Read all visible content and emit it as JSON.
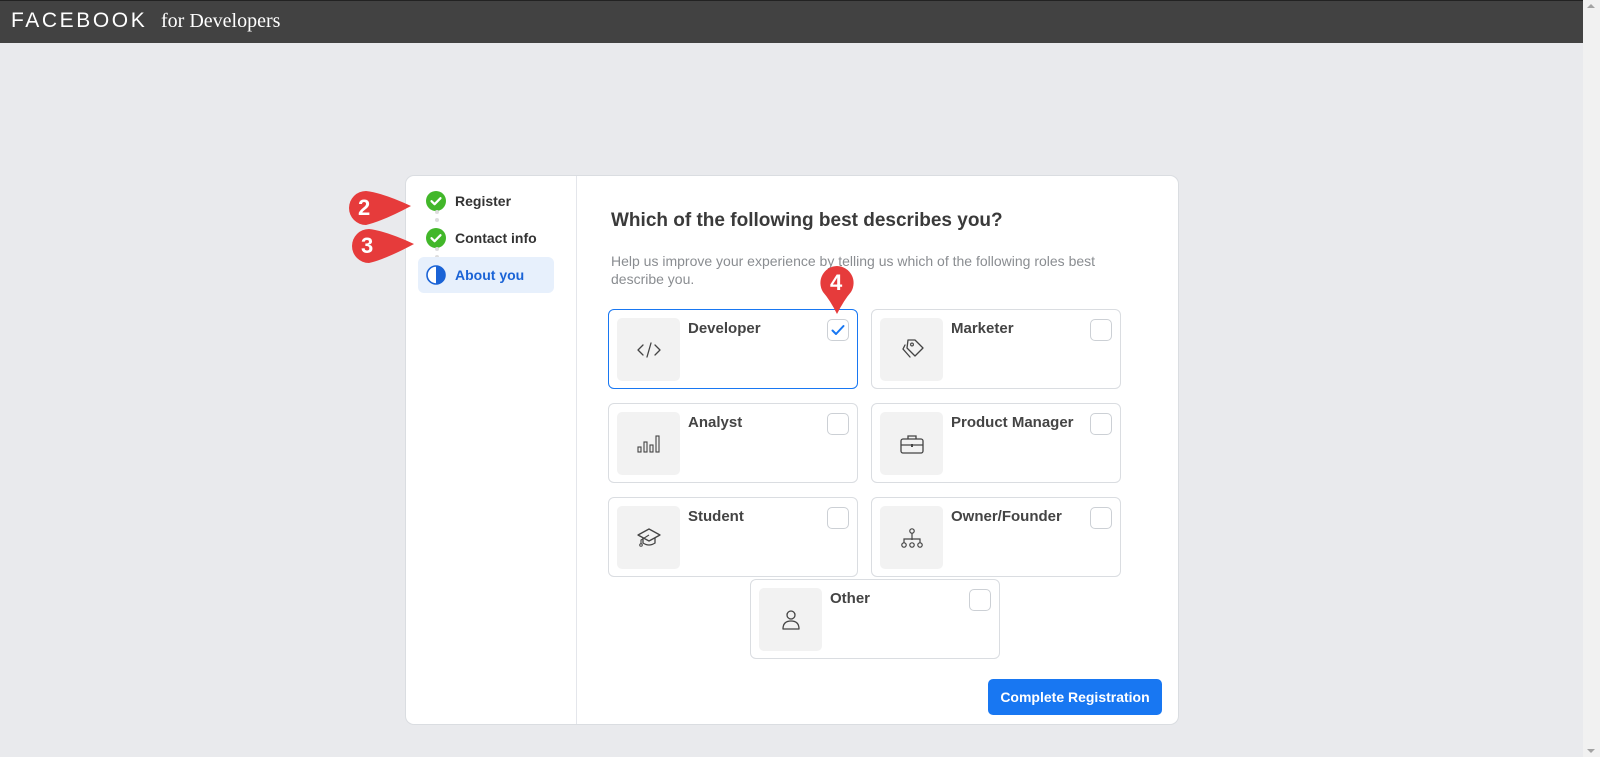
{
  "header": {
    "brand": "FACEBOOK",
    "brand_sub": "for Developers"
  },
  "steps": [
    {
      "label": "Register",
      "status": "complete"
    },
    {
      "label": "Contact info",
      "status": "complete"
    },
    {
      "label": "About you",
      "status": "current"
    }
  ],
  "main": {
    "title": "Which of the following best describes you?",
    "subtitle": "Help us improve your experience by telling us which of the following roles best describe you.",
    "roles": [
      {
        "label": "Developer",
        "icon": "code-icon",
        "checked": true
      },
      {
        "label": "Marketer",
        "icon": "tag-icon",
        "checked": false
      },
      {
        "label": "Analyst",
        "icon": "bar-chart-icon",
        "checked": false
      },
      {
        "label": "Product Manager",
        "icon": "briefcase-icon",
        "checked": false
      },
      {
        "label": "Student",
        "icon": "graduation-cap-icon",
        "checked": false
      },
      {
        "label": "Owner/Founder",
        "icon": "org-chart-icon",
        "checked": false
      },
      {
        "label": "Other",
        "icon": "person-icon",
        "checked": false
      }
    ],
    "complete_button": "Complete Registration"
  },
  "annotations": [
    "2",
    "3",
    "4"
  ],
  "colors": {
    "accent": "#1877f2",
    "success": "#42b72a",
    "annotation": "#e63b3b"
  }
}
